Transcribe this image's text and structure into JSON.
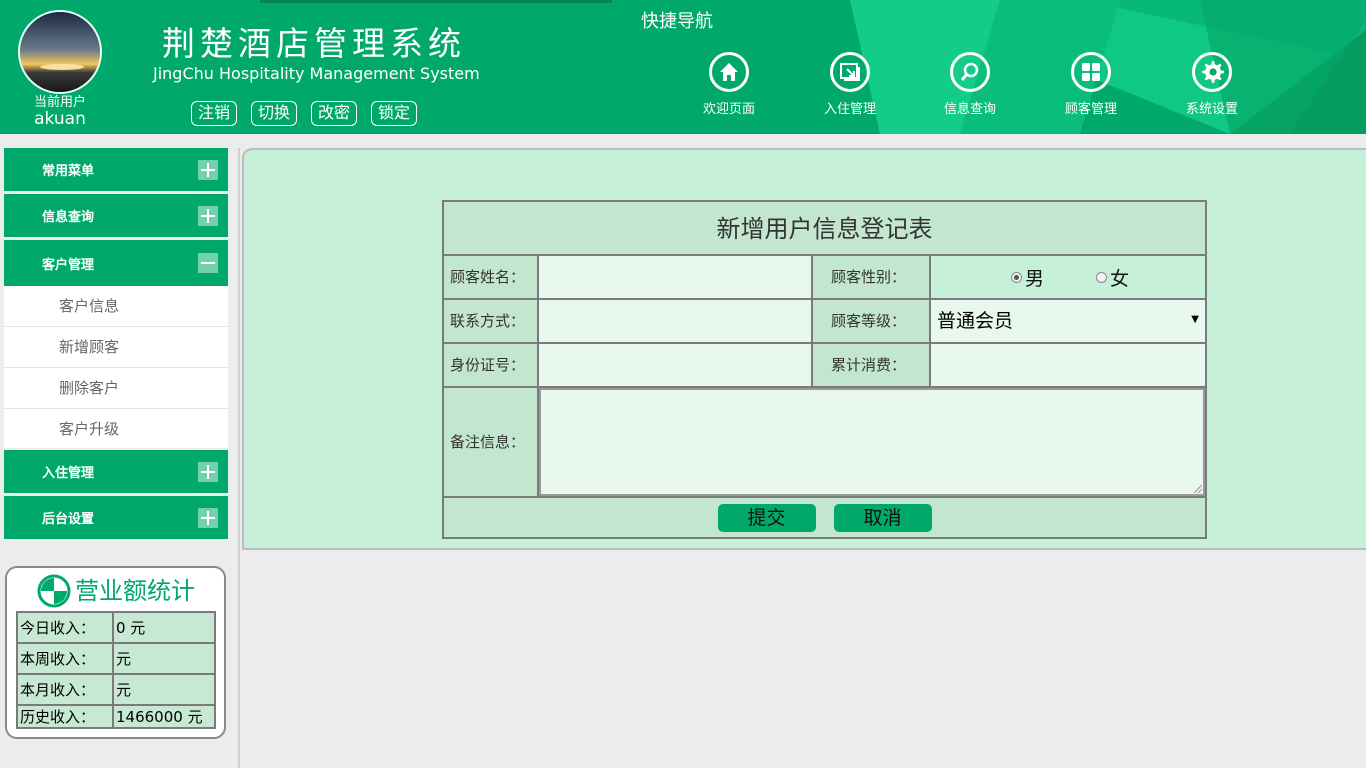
{
  "header": {
    "user_caption": "当前用户",
    "user_name": "akuan",
    "title_cn": "荆楚酒店管理系统",
    "title_en": "JingChu Hospitality Management System",
    "account_buttons": [
      "注销",
      "切换",
      "改密",
      "锁定"
    ],
    "quick_nav_title": "快捷导航",
    "quick_nav": [
      {
        "label": "欢迎页面",
        "icon": "home-icon"
      },
      {
        "label": "入住管理",
        "icon": "checkin-icon"
      },
      {
        "label": "信息查询",
        "icon": "search-icon"
      },
      {
        "label": "顾客管理",
        "icon": "grid-icon"
      },
      {
        "label": "系统设置",
        "icon": "gear-icon"
      }
    ]
  },
  "sidebar": {
    "menus": [
      {
        "label": "常用菜单",
        "expanded": false
      },
      {
        "label": "信息查询",
        "expanded": false
      },
      {
        "label": "客户管理",
        "expanded": true,
        "items": [
          "客户信息",
          "新增顾客",
          "删除客户",
          "客户升级"
        ]
      },
      {
        "label": "入住管理",
        "expanded": false
      },
      {
        "label": "后台设置",
        "expanded": false
      }
    ]
  },
  "stats": {
    "title": "营业额统计",
    "rows": [
      {
        "label": "今日收入：",
        "value": "0 元"
      },
      {
        "label": "本周收入：",
        "value": "元"
      },
      {
        "label": "本月收入：",
        "value": "元"
      },
      {
        "label": "历史收入：",
        "value": "1466000 元"
      }
    ]
  },
  "form": {
    "title": "新增用户信息登记表",
    "name_label": "顾客姓名：",
    "name_value": "",
    "gender_label": "顾客性别：",
    "gender_options": [
      "男",
      "女"
    ],
    "gender_selected": "男",
    "contact_label": "联系方式：",
    "contact_value": "",
    "level_label": "顾客等级：",
    "level_value": "普通会员",
    "id_label": "身份证号：",
    "id_value": "",
    "spend_label": "累计消费：",
    "spend_value": "",
    "notes_label": "备注信息：",
    "notes_value": "",
    "submit_label": "提交",
    "cancel_label": "取消"
  },
  "colors": {
    "brand_green": "#00a86b",
    "panel_bg": "#c6f0d8",
    "cell_bg": "#c3e6cf"
  }
}
